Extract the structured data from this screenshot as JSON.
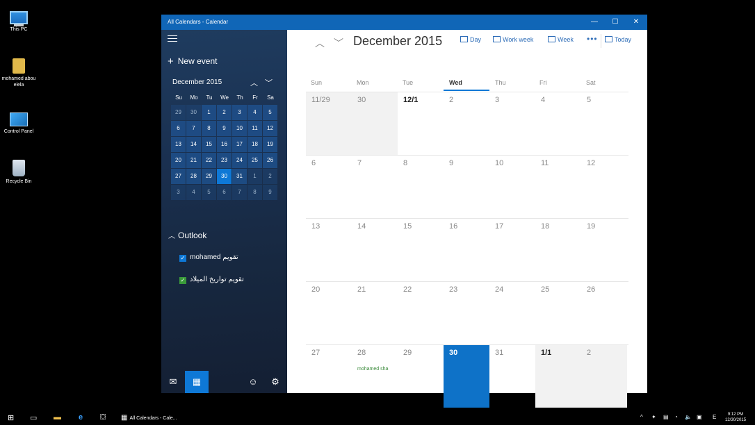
{
  "desktop": {
    "icons": [
      {
        "label": "This PC",
        "icon": "pc-icon"
      },
      {
        "label": "mohamed abou elela",
        "icon": "user-folder-icon"
      },
      {
        "label": "Control Panel",
        "icon": "control-panel-icon"
      },
      {
        "label": "Recycle Bin",
        "icon": "recycle-bin-icon"
      }
    ]
  },
  "window": {
    "title": "All Calendars - Calendar",
    "minimize": "—",
    "maximize": "☐",
    "close": "✕"
  },
  "sidebar": {
    "new_event": "New event",
    "mini_month": "December 2015",
    "weekdays": [
      "Su",
      "Mo",
      "Tu",
      "We",
      "Th",
      "Fr",
      "Sa"
    ],
    "weeks": [
      [
        "29",
        "30",
        "1",
        "2",
        "3",
        "4",
        "5"
      ],
      [
        "6",
        "7",
        "8",
        "9",
        "10",
        "11",
        "12"
      ],
      [
        "13",
        "14",
        "15",
        "16",
        "17",
        "18",
        "19"
      ],
      [
        "20",
        "21",
        "22",
        "23",
        "24",
        "25",
        "26"
      ],
      [
        "27",
        "28",
        "29",
        "30",
        "31",
        "1",
        "2"
      ],
      [
        "3",
        "4",
        "5",
        "6",
        "7",
        "8",
        "9"
      ]
    ],
    "outlook_label": "Outlook",
    "calendars": [
      {
        "name": "mohamed تقويم",
        "color": "#0e78d6",
        "checked": "✓"
      },
      {
        "name": "تقويم تواريخ الميلاد",
        "color": "#3a9a3a",
        "checked": "✓"
      }
    ]
  },
  "toolbar": {
    "month_title": "December 2015",
    "prev": "︿",
    "next": "﹀",
    "day": "Day",
    "work_week": "Work week",
    "week": "Week",
    "more": "•••",
    "today": "Today"
  },
  "month": {
    "weekdays": [
      "Sun",
      "Mon",
      "Tue",
      "Wed",
      "Thu",
      "Fri",
      "Sat"
    ],
    "weeks": [
      [
        "11/29",
        "30",
        "12/1",
        "2",
        "3",
        "4",
        "5"
      ],
      [
        "6",
        "7",
        "8",
        "9",
        "10",
        "11",
        "12"
      ],
      [
        "13",
        "14",
        "15",
        "16",
        "17",
        "18",
        "19"
      ],
      [
        "20",
        "21",
        "22",
        "23",
        "24",
        "25",
        "26"
      ],
      [
        "27",
        "28",
        "29",
        "30",
        "31",
        "1/1",
        "2"
      ]
    ],
    "event": "mohamed sha"
  },
  "taskbar": {
    "app_label": "All Calendars - Cale...",
    "time": "9:12 PM",
    "date": "12/30/2015",
    "lang": "E"
  }
}
